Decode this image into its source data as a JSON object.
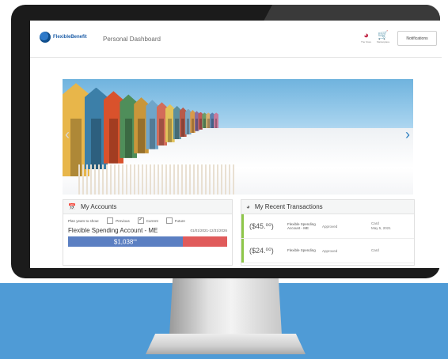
{
  "header": {
    "logo_text": "FlexibleBenefit",
    "page_title": "Personal Dashboard",
    "tool_1_label": "The Store",
    "tool_2_label": "Marketplace",
    "notifications_label": "Notifications",
    "tool_1_icon": "store-icon",
    "tool_2_icon": "cart-icon"
  },
  "hero": {
    "prev_glyph": "‹",
    "next_glyph": "›"
  },
  "accounts": {
    "title": "My Accounts",
    "plan_years_label": "Plan years to show:",
    "filters": [
      {
        "label": "Previous",
        "checked": false
      },
      {
        "label": "Current",
        "checked": true
      },
      {
        "label": "Future",
        "checked": false
      }
    ],
    "account_name": "Flexible Spending Account - ME",
    "account_dates": "01/01/2021-12/31/2026",
    "balance": "$1,038",
    "balance_cents": "00",
    "balance_fraction": 0.72
  },
  "transactions": {
    "title": "My Recent Transactions",
    "items": [
      {
        "amount": "($45.⁰⁰)",
        "desc": "Flexible Spending Account - ME",
        "status": "Approved",
        "type": "Card",
        "date": "May 5, 2021"
      },
      {
        "amount": "($24.⁰⁰)",
        "desc": "Flexible Spending",
        "status": "Approved",
        "type": "Card",
        "date": ""
      }
    ]
  },
  "colors": {
    "band": "#4f9bd6",
    "balance_bar": "#5b7fc2",
    "balance_remaining": "#e05b5b",
    "tx_accent": "#8fc74a"
  }
}
